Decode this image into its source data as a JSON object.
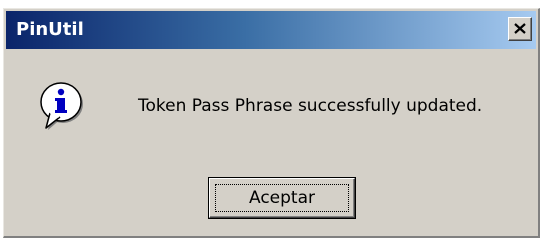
{
  "window": {
    "title": "PinUtil",
    "close_icon": "close-x-icon"
  },
  "dialog": {
    "icon": "information-speech-bubble-icon",
    "message": "Token Pass Phrase successfully updated.",
    "ok_button_label": "Aceptar"
  },
  "colors": {
    "dialog_face": "#d4d0c8",
    "title_gradient_start": "#0a246a",
    "title_gradient_end": "#a6caf0",
    "title_text": "#ffffff",
    "icon_blue": "#0000c0"
  }
}
